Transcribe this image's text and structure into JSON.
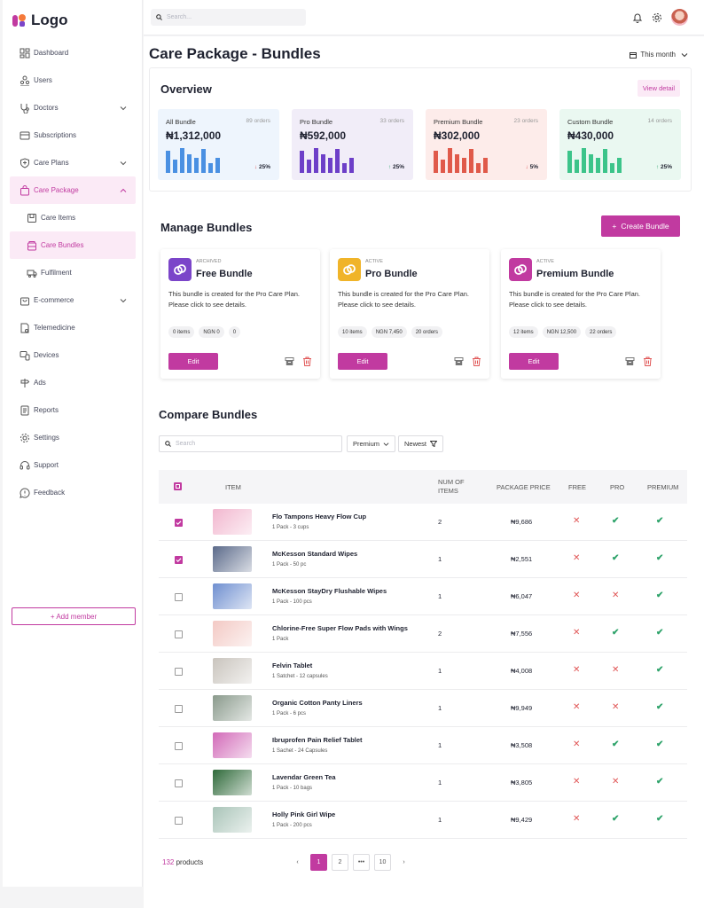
{
  "logo": {
    "text": "Logo"
  },
  "sidebar": {
    "items": [
      {
        "label": "Dashboard"
      },
      {
        "label": "Users"
      },
      {
        "label": "Doctors"
      },
      {
        "label": "Subscriptions"
      },
      {
        "label": "Care Plans"
      },
      {
        "label": "Care Package"
      },
      {
        "label": "Care Items"
      },
      {
        "label": "Care Bundles"
      },
      {
        "label": "Fulfilment"
      },
      {
        "label": "E-commerce"
      },
      {
        "label": "Telemedicine"
      },
      {
        "label": "Devices"
      },
      {
        "label": "Ads"
      },
      {
        "label": "Reports"
      },
      {
        "label": "Settings"
      },
      {
        "label": "Support"
      },
      {
        "label": "Feedback"
      }
    ],
    "add_member": "+ Add member"
  },
  "topbar": {
    "search_placeholder": "Search..."
  },
  "page": {
    "title": "Care Package - Bundles",
    "period": "This month"
  },
  "overview": {
    "title": "Overview",
    "view_detail": "View detail",
    "stats": [
      {
        "label": "All Bundle",
        "orders": "89 orders",
        "amount": "₦1,312,000",
        "change": "25%",
        "dir": "down",
        "color": "#4a90e2",
        "bg": "#eef5fd",
        "bars": [
          0.9,
          0.55,
          1.0,
          0.75,
          0.6,
          0.95,
          0.4,
          0.6
        ]
      },
      {
        "label": "Pro Bundle",
        "orders": "33 orders",
        "amount": "₦592,000",
        "change": "25%",
        "dir": "up",
        "color": "#6d3fc8",
        "bg": "#f1edf8",
        "bars": [
          0.9,
          0.55,
          1.0,
          0.75,
          0.6,
          0.95,
          0.4,
          0.6
        ]
      },
      {
        "label": "Premium Bundle",
        "orders": "23 orders",
        "amount": "₦302,000",
        "change": "5%",
        "dir": "down",
        "color": "#e05a4a",
        "bg": "#fdecea",
        "bars": [
          0.9,
          0.55,
          1.0,
          0.75,
          0.6,
          0.95,
          0.4,
          0.6
        ]
      },
      {
        "label": "Custom Bundle",
        "orders": "14 orders",
        "amount": "₦430,000",
        "change": "25%",
        "dir": "up",
        "color": "#3cc48a",
        "bg": "#eaf8f1",
        "bars": [
          0.9,
          0.55,
          1.0,
          0.75,
          0.6,
          0.95,
          0.4,
          0.6
        ]
      }
    ]
  },
  "manage": {
    "title": "Manage Bundles",
    "create": "Create Bundle",
    "bundles": [
      {
        "status": "ARCHIVED",
        "name": "Free Bundle",
        "desc": "This bundle is created for the Pro Care Plan. Please click to see details.",
        "chips": [
          "0 items",
          "NGN 0",
          "0"
        ],
        "edit": "Edit",
        "color": "#7b45c9"
      },
      {
        "status": "ACTIVE",
        "name": "Pro Bundle",
        "desc": "This bundle is created for the Pro Care Plan. Please click to see details.",
        "chips": [
          "10 items",
          "NGN 7,450",
          "20 orders"
        ],
        "edit": "Edit",
        "color": "#f0b429"
      },
      {
        "status": "ACTIVE",
        "name": "Premium Bundle",
        "desc": "This bundle is created for the Pro Care Plan. Please click to see details.",
        "chips": [
          "12 items",
          "NGN 12,500",
          "22 orders"
        ],
        "edit": "Edit",
        "color": "#c13aa0"
      }
    ]
  },
  "compare": {
    "title": "Compare Bundles",
    "search_placeholder": "Search",
    "filter": "Premium",
    "sort": "Newest",
    "headers": {
      "item": "ITEM",
      "num_items": "NUM OF ITEMS",
      "price": "PACKAGE PRICE",
      "free": "FREE",
      "pro": "PRO",
      "premium": "PREMIUM"
    },
    "rows": [
      {
        "checked": true,
        "name": "Flo Tampons Heavy Flow Cup",
        "sub": "1 Pack - 3 cups",
        "num": "2",
        "price": "₦9,686",
        "free": false,
        "pro": true,
        "premium": true,
        "thumb": "#f2b7cf"
      },
      {
        "checked": true,
        "name": "McKesson Standard Wipes",
        "sub": "1 Pack - 50 pc",
        "num": "1",
        "price": "₦2,551",
        "free": false,
        "pro": true,
        "premium": true,
        "thumb": "#5b6a8a"
      },
      {
        "checked": false,
        "name": "McKesson StayDry Flushable Wipes",
        "sub": "1 Pack - 100 pcs",
        "num": "1",
        "price": "₦6,047",
        "free": false,
        "pro": false,
        "premium": true,
        "thumb": "#6f8fd0"
      },
      {
        "checked": false,
        "name": "Chlorine-Free Super Flow Pads with Wings",
        "sub": "1 Pack",
        "num": "2",
        "price": "₦7,556",
        "free": false,
        "pro": true,
        "premium": true,
        "thumb": "#f3c9c4"
      },
      {
        "checked": false,
        "name": "Felvin Tablet",
        "sub": "1 Satchet - 12 capsules",
        "num": "1",
        "price": "₦4,008",
        "free": false,
        "pro": false,
        "premium": true,
        "thumb": "#c9c4bd"
      },
      {
        "checked": false,
        "name": "Organic Cotton Panty Liners",
        "sub": "1 Pack - 6 pcs",
        "num": "1",
        "price": "₦9,949",
        "free": false,
        "pro": false,
        "premium": true,
        "thumb": "#8a9a8c"
      },
      {
        "checked": false,
        "name": "Ibruprofen Pain Relief Tablet",
        "sub": "1 Sachet - 24 Capsules",
        "num": "1",
        "price": "₦3,508",
        "free": false,
        "pro": true,
        "premium": true,
        "thumb": "#d26ab8"
      },
      {
        "checked": false,
        "name": "Lavendar Green Tea",
        "sub": "1 Pack - 10 bags",
        "num": "1",
        "price": "₦3,805",
        "free": false,
        "pro": false,
        "premium": true,
        "thumb": "#2f6a3a"
      },
      {
        "checked": false,
        "name": "Holly Pink Girl Wipe",
        "sub": "1 Pack - 200 pcs",
        "num": "1",
        "price": "₦9,429",
        "free": false,
        "pro": true,
        "premium": true,
        "thumb": "#a9c4b8"
      }
    ],
    "count": "132",
    "count_label": " products",
    "pages": [
      "1",
      "2",
      "•••",
      "10"
    ]
  }
}
